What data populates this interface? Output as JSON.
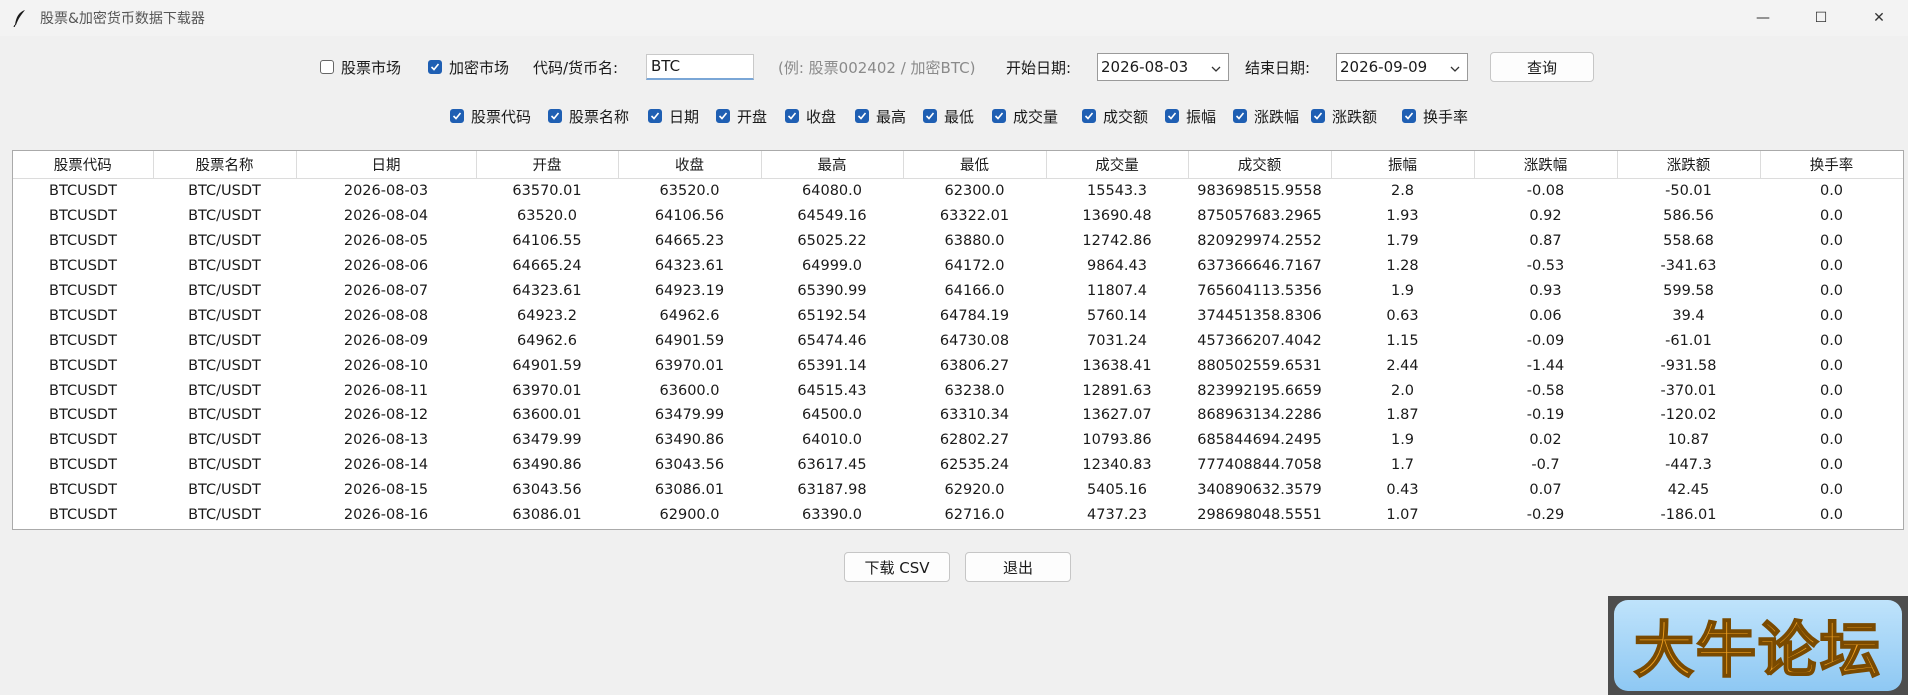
{
  "window": {
    "title": "股票&加密货币数据下载器",
    "controls": {
      "minimize": "—",
      "maximize": "☐",
      "close": "✕"
    }
  },
  "query": {
    "stock_market_label": "股票市场",
    "stock_market_checked": false,
    "crypto_market_label": "加密市场",
    "crypto_market_checked": true,
    "code_label": "代码/货币名:",
    "code_value": "BTC",
    "hint": "(例: 股票002402 / 加密BTC)",
    "start_label": "开始日期:",
    "start_value": "2026-08-03",
    "end_label": "结束日期:",
    "end_value": "2026-09-09",
    "query_button": "查询"
  },
  "columns": [
    {
      "label": "股票代码",
      "checked": true
    },
    {
      "label": "股票名称",
      "checked": true
    },
    {
      "label": "日期",
      "checked": true
    },
    {
      "label": "开盘",
      "checked": true
    },
    {
      "label": "收盘",
      "checked": true
    },
    {
      "label": "最高",
      "checked": true
    },
    {
      "label": "最低",
      "checked": true
    },
    {
      "label": "成交量",
      "checked": true
    },
    {
      "label": "成交额",
      "checked": true
    },
    {
      "label": "振幅",
      "checked": true
    },
    {
      "label": "涨跌幅",
      "checked": true
    },
    {
      "label": "涨跌额",
      "checked": true
    },
    {
      "label": "换手率",
      "checked": true
    }
  ],
  "table": {
    "headers": [
      "股票代码",
      "股票名称",
      "日期",
      "开盘",
      "收盘",
      "最高",
      "最低",
      "成交量",
      "成交额",
      "振幅",
      "涨跌幅",
      "涨跌额",
      "换手率"
    ],
    "rows": [
      [
        "BTCUSDT",
        "BTC/USDT",
        "2026-08-03",
        "63570.01",
        "63520.0",
        "64080.0",
        "62300.0",
        "15543.3",
        "983698515.9558",
        "2.8",
        "-0.08",
        "-50.01",
        "0.0"
      ],
      [
        "BTCUSDT",
        "BTC/USDT",
        "2026-08-04",
        "63520.0",
        "64106.56",
        "64549.16",
        "63322.01",
        "13690.48",
        "875057683.2965",
        "1.93",
        "0.92",
        "586.56",
        "0.0"
      ],
      [
        "BTCUSDT",
        "BTC/USDT",
        "2026-08-05",
        "64106.55",
        "64665.23",
        "65025.22",
        "63880.0",
        "12742.86",
        "820929974.2552",
        "1.79",
        "0.87",
        "558.68",
        "0.0"
      ],
      [
        "BTCUSDT",
        "BTC/USDT",
        "2026-08-06",
        "64665.24",
        "64323.61",
        "64999.0",
        "64172.0",
        "9864.43",
        "637366646.7167",
        "1.28",
        "-0.53",
        "-341.63",
        "0.0"
      ],
      [
        "BTCUSDT",
        "BTC/USDT",
        "2026-08-07",
        "64323.61",
        "64923.19",
        "65390.99",
        "64166.0",
        "11807.4",
        "765604113.5356",
        "1.9",
        "0.93",
        "599.58",
        "0.0"
      ],
      [
        "BTCUSDT",
        "BTC/USDT",
        "2026-08-08",
        "64923.2",
        "64962.6",
        "65192.54",
        "64784.19",
        "5760.14",
        "374451358.8306",
        "0.63",
        "0.06",
        "39.4",
        "0.0"
      ],
      [
        "BTCUSDT",
        "BTC/USDT",
        "2026-08-09",
        "64962.6",
        "64901.59",
        "65474.46",
        "64730.08",
        "7031.24",
        "457366207.4042",
        "1.15",
        "-0.09",
        "-61.01",
        "0.0"
      ],
      [
        "BTCUSDT",
        "BTC/USDT",
        "2026-08-10",
        "64901.59",
        "63970.01",
        "65391.14",
        "63806.27",
        "13638.41",
        "880502559.6531",
        "2.44",
        "-1.44",
        "-931.58",
        "0.0"
      ],
      [
        "BTCUSDT",
        "BTC/USDT",
        "2026-08-11",
        "63970.01",
        "63600.0",
        "64515.43",
        "63238.0",
        "12891.63",
        "823992195.6659",
        "2.0",
        "-0.58",
        "-370.01",
        "0.0"
      ],
      [
        "BTCUSDT",
        "BTC/USDT",
        "2026-08-12",
        "63600.01",
        "63479.99",
        "64500.0",
        "63310.34",
        "13627.07",
        "868963134.2286",
        "1.87",
        "-0.19",
        "-120.02",
        "0.0"
      ],
      [
        "BTCUSDT",
        "BTC/USDT",
        "2026-08-13",
        "63479.99",
        "63490.86",
        "64010.0",
        "62802.27",
        "10793.86",
        "685844694.2495",
        "1.9",
        "0.02",
        "10.87",
        "0.0"
      ],
      [
        "BTCUSDT",
        "BTC/USDT",
        "2026-08-14",
        "63490.86",
        "63043.56",
        "63617.45",
        "62535.24",
        "12340.83",
        "777408844.7058",
        "1.7",
        "-0.7",
        "-447.3",
        "0.0"
      ],
      [
        "BTCUSDT",
        "BTC/USDT",
        "2026-08-15",
        "63043.56",
        "63086.01",
        "63187.98",
        "62920.0",
        "5405.16",
        "340890632.3579",
        "0.43",
        "0.07",
        "42.45",
        "0.0"
      ],
      [
        "BTCUSDT",
        "BTC/USDT",
        "2026-08-16",
        "63086.01",
        "62900.0",
        "63390.0",
        "62716.0",
        "4737.23",
        "298698048.5551",
        "1.07",
        "-0.29",
        "-186.01",
        "0.0"
      ]
    ]
  },
  "bottom": {
    "download_button": "下载 CSV",
    "exit_button": "退出"
  },
  "watermark": {
    "text": "大牛论坛"
  },
  "colors": {
    "accent": "#1f5fb3"
  }
}
